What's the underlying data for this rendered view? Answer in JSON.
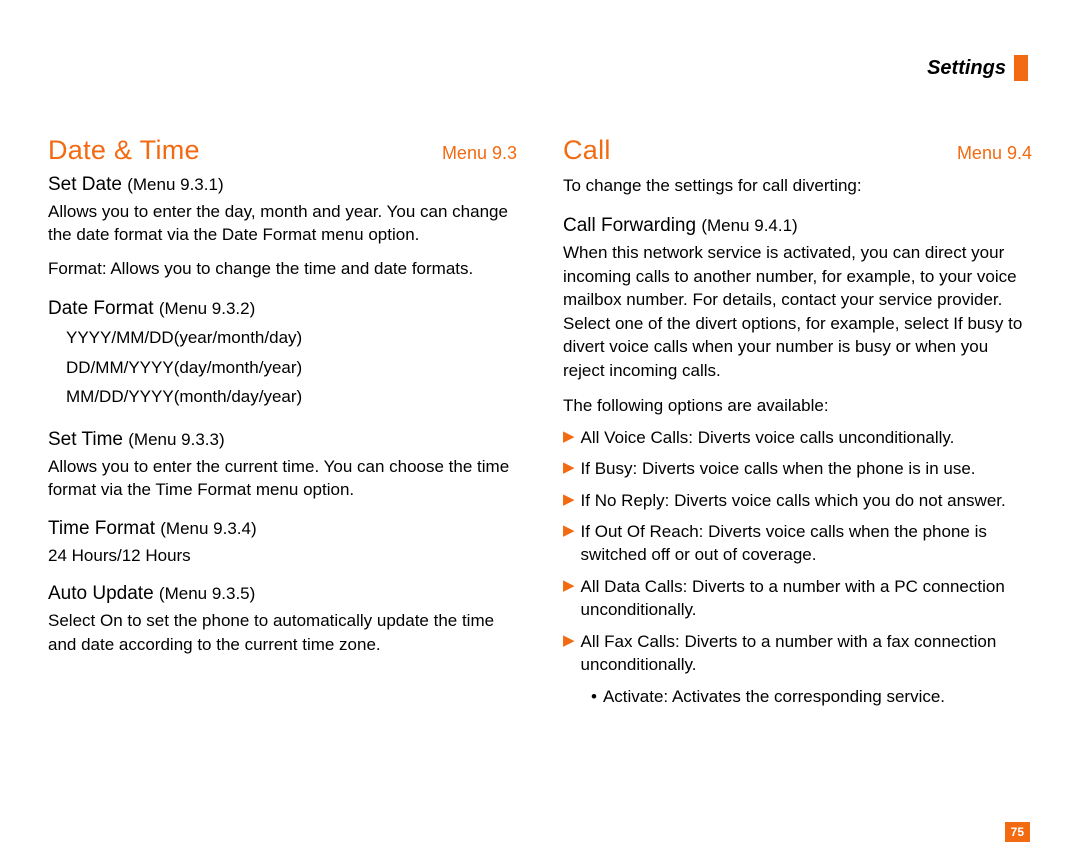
{
  "header": {
    "title": "Settings",
    "pageNumber": "75"
  },
  "left": {
    "title": "Date & Time",
    "menu": "Menu 9.3",
    "setDate": {
      "heading": "Set Date",
      "menuref": "(Menu 9.3.1)",
      "p1a": "Allows you to enter the day, month and year. You can change the date format via the ",
      "p1b": "Date Format",
      "p1c": " menu option.",
      "p2": "Format: Allows you to change the time and date formats."
    },
    "dateFormat": {
      "heading": "Date Format",
      "menuref": "(Menu 9.3.2)",
      "l1a": "YYYY/MM/DD",
      "l1b": "(year/month/day)",
      "l2a": "DD/MM/YYYY",
      "l2b": "(day/month/year)",
      "l3a": "MM/DD/YYYY",
      "l3b": "(month/day/year)"
    },
    "setTime": {
      "heading": "Set Time",
      "menuref": "(Menu 9.3.3)",
      "p": "Allows you to enter the current time. You can choose the time format via the Time Format menu option."
    },
    "timeFormat": {
      "heading": "Time Format",
      "menuref": "(Menu 9.3.4)",
      "p": "24 Hours/12 Hours"
    },
    "autoUpdate": {
      "heading": "Auto Update",
      "menuref": "(Menu 9.3.5)",
      "p1a": "Select ",
      "p1b": "On",
      "p1c": " to set the phone to automatically update the time and date according to the current time zone."
    }
  },
  "right": {
    "title": "Call",
    "menu": "Menu 9.4",
    "intro": "To change the settings for call diverting:",
    "callFwd": {
      "heading": "Call Forwarding",
      "menuref": "(Menu 9.4.1)",
      "p1a": "When this network service is activated, you can direct your incoming calls to another number, for example, to your voice mailbox number. For details, contact your service provider. Select one of the divert options, for example, select ",
      "p1b": "If busy",
      "p1c": " to divert voice calls when your number is busy or when you reject incoming calls.",
      "p2": "The following options are available:",
      "opts": [
        {
          "b": "All Voice Calls:",
          "t": " Diverts voice calls unconditionally."
        },
        {
          "b": "If Busy:",
          "t": " Diverts voice calls when the phone is in use."
        },
        {
          "b": "If No Reply:",
          "t": " Diverts voice calls which you do not answer."
        },
        {
          "b": "If Out Of Reach:",
          "t": " Diverts voice calls when the phone is switched off or out of coverage."
        },
        {
          "b": "All Data Calls:",
          "t": " Diverts to a number with a PC connection unconditionally."
        },
        {
          "b": "All Fax Calls:",
          "t": " Diverts to a number with a fax connection unconditionally."
        }
      ],
      "subBullet": "•",
      "subB": "Activate:",
      "subT": " Activates the corresponding service."
    }
  }
}
